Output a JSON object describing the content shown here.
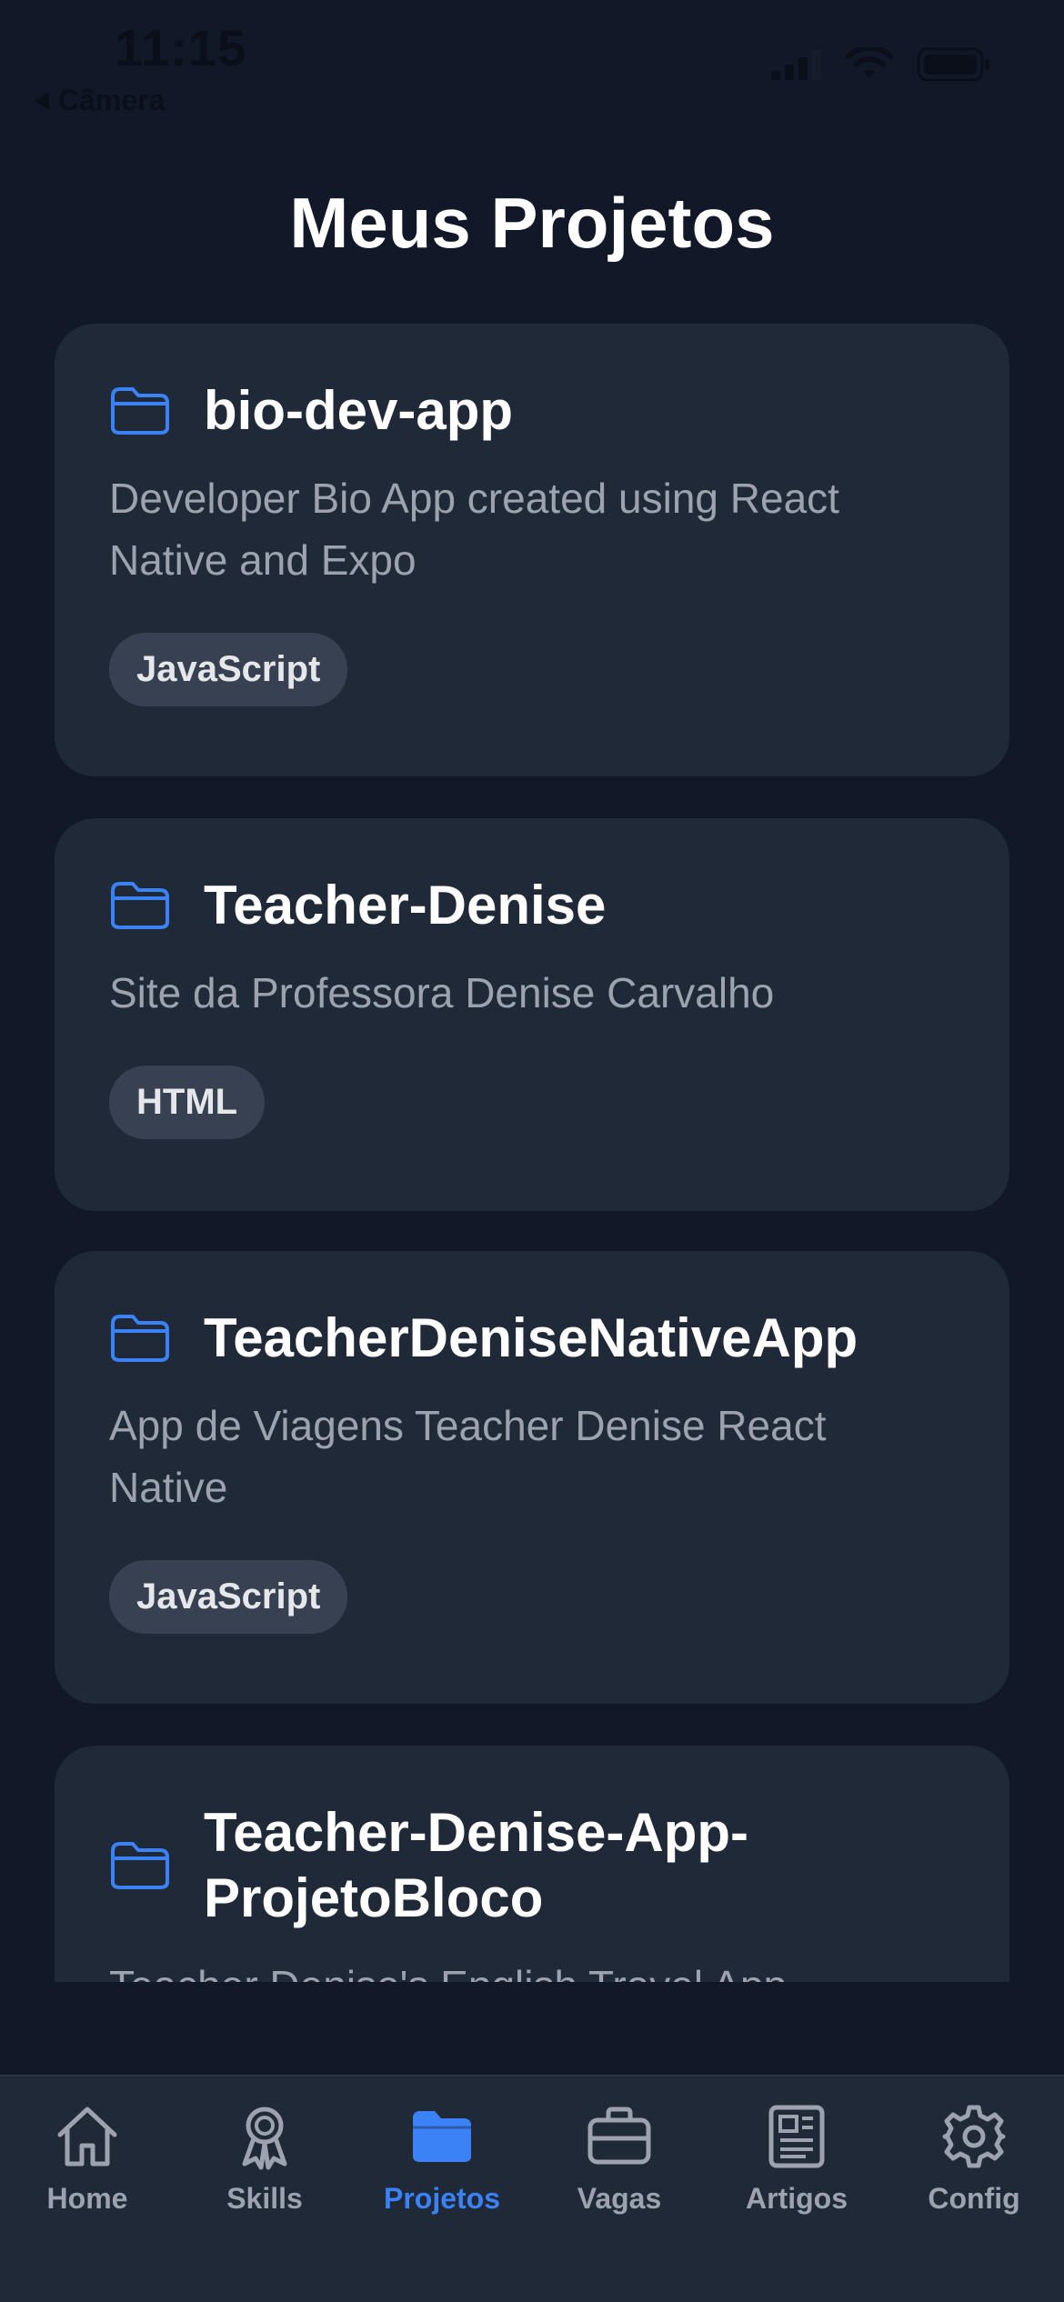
{
  "status_bar": {
    "time": "11:15",
    "back_label": "Câmera"
  },
  "page": {
    "title": "Meus Projetos"
  },
  "projects": [
    {
      "name": "bio-dev-app",
      "description": "Developer Bio App created using React Native and Expo",
      "language": "JavaScript"
    },
    {
      "name": "Teacher-Denise",
      "description": "Site da Professora Denise Carvalho",
      "language": "HTML"
    },
    {
      "name": "TeacherDeniseNativeApp",
      "description": "App de Viagens Teacher Denise React Native",
      "language": "JavaScript"
    },
    {
      "name": "Teacher-Denise-App-ProjetoBloco",
      "description": "Teacher Denise's English Travel App"
    }
  ],
  "tab_bar": {
    "tabs": [
      {
        "label": "Home",
        "icon": "home-icon"
      },
      {
        "label": "Skills",
        "icon": "award-icon"
      },
      {
        "label": "Projetos",
        "icon": "folder-icon"
      },
      {
        "label": "Vagas",
        "icon": "briefcase-icon"
      },
      {
        "label": "Artigos",
        "icon": "newspaper-icon"
      },
      {
        "label": "Config",
        "icon": "gear-icon"
      }
    ],
    "active_tab": "Projetos"
  },
  "colors": {
    "background": "#111827",
    "card": "#1f2937",
    "accent": "#3b82f6",
    "muted_text": "#9ca3af",
    "tag_background": "#374151"
  }
}
